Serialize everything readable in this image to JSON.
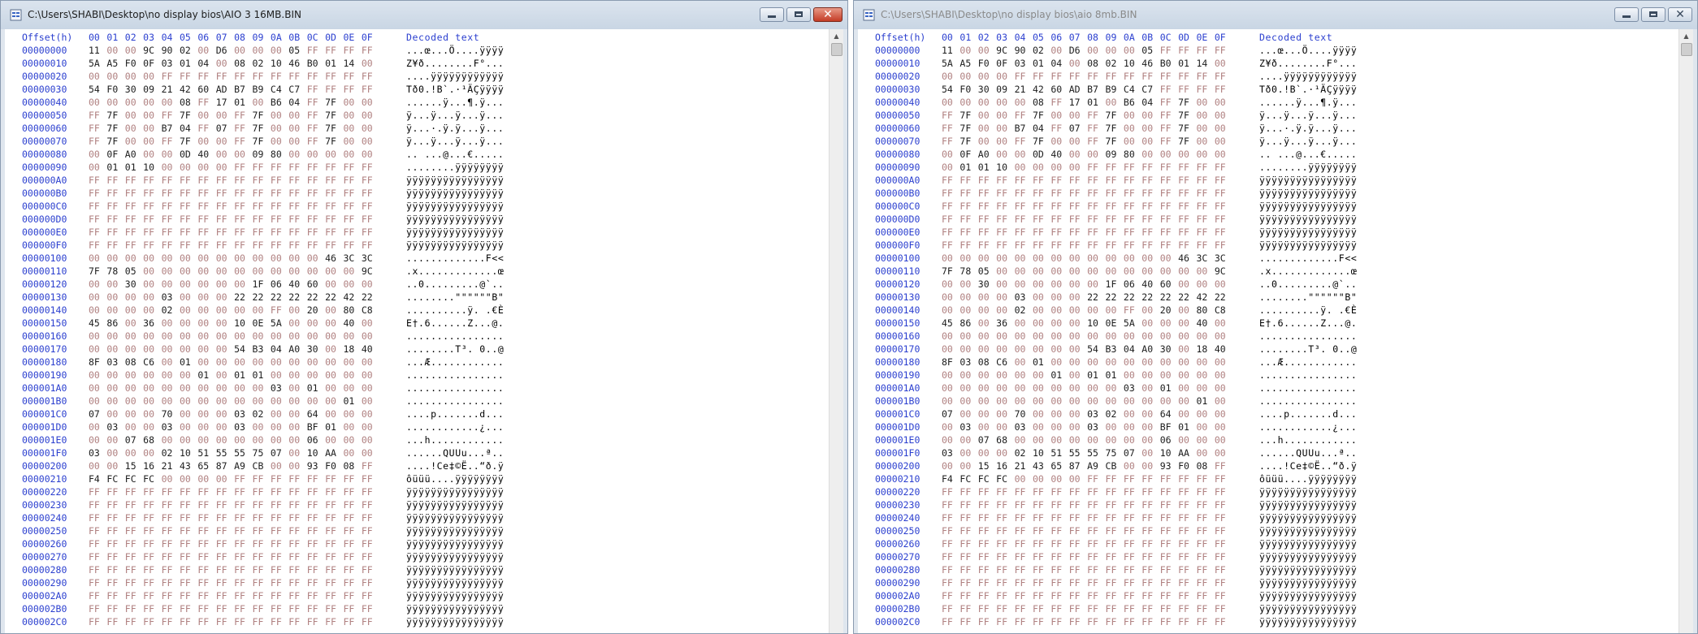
{
  "windows": [
    {
      "id": "left",
      "title": "C:\\Users\\SHABI\\Desktop\\no display bios\\AIO 3 16MB.BIN"
    },
    {
      "id": "right",
      "title": "C:\\Users\\SHABI\\Desktop\\no display bios\\aio 8mb.BIN"
    }
  ],
  "header": {
    "offset_label": "Offset(h)",
    "columns": [
      "00",
      "01",
      "02",
      "03",
      "04",
      "05",
      "06",
      "07",
      "08",
      "09",
      "0A",
      "0B",
      "0C",
      "0D",
      "0E",
      "0F"
    ],
    "decoded_label": "Decoded text"
  },
  "rows": [
    {
      "offset": "00000000",
      "bytes": [
        "11",
        "00",
        "00",
        "9C",
        "90",
        "02",
        "00",
        "D6",
        "00",
        "00",
        "00",
        "05",
        "FF",
        "FF",
        "FF",
        "FF"
      ],
      "text": "...œ...Ö....ÿÿÿÿ"
    },
    {
      "offset": "00000010",
      "bytes": [
        "5A",
        "A5",
        "F0",
        "0F",
        "03",
        "01",
        "04",
        "00",
        "08",
        "02",
        "10",
        "46",
        "B0",
        "01",
        "14",
        "00"
      ],
      "text": "Z¥ð........F°..."
    },
    {
      "offset": "00000020",
      "bytes": [
        "00",
        "00",
        "00",
        "00",
        "FF",
        "FF",
        "FF",
        "FF",
        "FF",
        "FF",
        "FF",
        "FF",
        "FF",
        "FF",
        "FF",
        "FF"
      ],
      "text": "....ÿÿÿÿÿÿÿÿÿÿÿÿ"
    },
    {
      "offset": "00000030",
      "bytes": [
        "54",
        "F0",
        "30",
        "09",
        "21",
        "42",
        "60",
        "AD",
        "B7",
        "B9",
        "C4",
        "C7",
        "FF",
        "FF",
        "FF",
        "FF"
      ],
      "text": "Tð0.!B`.·¹ÄÇÿÿÿÿ"
    },
    {
      "offset": "00000040",
      "bytes": [
        "00",
        "00",
        "00",
        "00",
        "00",
        "08",
        "FF",
        "17",
        "01",
        "00",
        "B6",
        "04",
        "FF",
        "7F",
        "00",
        "00"
      ],
      "text": "......ÿ...¶.ÿ..."
    },
    {
      "offset": "00000050",
      "bytes": [
        "FF",
        "7F",
        "00",
        "00",
        "FF",
        "7F",
        "00",
        "00",
        "FF",
        "7F",
        "00",
        "00",
        "FF",
        "7F",
        "00",
        "00"
      ],
      "text": "ÿ...ÿ...ÿ...ÿ..."
    },
    {
      "offset": "00000060",
      "bytes": [
        "FF",
        "7F",
        "00",
        "00",
        "B7",
        "04",
        "FF",
        "07",
        "FF",
        "7F",
        "00",
        "00",
        "FF",
        "7F",
        "00",
        "00"
      ],
      "text": "ÿ...·.ÿ.ÿ...ÿ..."
    },
    {
      "offset": "00000070",
      "bytes": [
        "FF",
        "7F",
        "00",
        "00",
        "FF",
        "7F",
        "00",
        "00",
        "FF",
        "7F",
        "00",
        "00",
        "FF",
        "7F",
        "00",
        "00"
      ],
      "text": "ÿ...ÿ...ÿ...ÿ..."
    },
    {
      "offset": "00000080",
      "bytes": [
        "00",
        "0F",
        "A0",
        "00",
        "00",
        "0D",
        "40",
        "00",
        "00",
        "09",
        "80",
        "00",
        "00",
        "00",
        "00",
        "00"
      ],
      "text": ".. ...@...€....."
    },
    {
      "offset": "00000090",
      "bytes": [
        "00",
        "01",
        "01",
        "10",
        "00",
        "00",
        "00",
        "00",
        "FF",
        "FF",
        "FF",
        "FF",
        "FF",
        "FF",
        "FF",
        "FF"
      ],
      "text": "........ÿÿÿÿÿÿÿÿ"
    },
    {
      "offset": "000000A0",
      "bytes": [
        "FF",
        "FF",
        "FF",
        "FF",
        "FF",
        "FF",
        "FF",
        "FF",
        "FF",
        "FF",
        "FF",
        "FF",
        "FF",
        "FF",
        "FF",
        "FF"
      ],
      "text": "ÿÿÿÿÿÿÿÿÿÿÿÿÿÿÿÿ"
    },
    {
      "offset": "000000B0",
      "bytes": [
        "FF",
        "FF",
        "FF",
        "FF",
        "FF",
        "FF",
        "FF",
        "FF",
        "FF",
        "FF",
        "FF",
        "FF",
        "FF",
        "FF",
        "FF",
        "FF"
      ],
      "text": "ÿÿÿÿÿÿÿÿÿÿÿÿÿÿÿÿ"
    },
    {
      "offset": "000000C0",
      "bytes": [
        "FF",
        "FF",
        "FF",
        "FF",
        "FF",
        "FF",
        "FF",
        "FF",
        "FF",
        "FF",
        "FF",
        "FF",
        "FF",
        "FF",
        "FF",
        "FF"
      ],
      "text": "ÿÿÿÿÿÿÿÿÿÿÿÿÿÿÿÿ"
    },
    {
      "offset": "000000D0",
      "bytes": [
        "FF",
        "FF",
        "FF",
        "FF",
        "FF",
        "FF",
        "FF",
        "FF",
        "FF",
        "FF",
        "FF",
        "FF",
        "FF",
        "FF",
        "FF",
        "FF"
      ],
      "text": "ÿÿÿÿÿÿÿÿÿÿÿÿÿÿÿÿ"
    },
    {
      "offset": "000000E0",
      "bytes": [
        "FF",
        "FF",
        "FF",
        "FF",
        "FF",
        "FF",
        "FF",
        "FF",
        "FF",
        "FF",
        "FF",
        "FF",
        "FF",
        "FF",
        "FF",
        "FF"
      ],
      "text": "ÿÿÿÿÿÿÿÿÿÿÿÿÿÿÿÿ"
    },
    {
      "offset": "000000F0",
      "bytes": [
        "FF",
        "FF",
        "FF",
        "FF",
        "FF",
        "FF",
        "FF",
        "FF",
        "FF",
        "FF",
        "FF",
        "FF",
        "FF",
        "FF",
        "FF",
        "FF"
      ],
      "text": "ÿÿÿÿÿÿÿÿÿÿÿÿÿÿÿÿ"
    },
    {
      "offset": "00000100",
      "bytes": [
        "00",
        "00",
        "00",
        "00",
        "00",
        "00",
        "00",
        "00",
        "00",
        "00",
        "00",
        "00",
        "00",
        "46",
        "3C",
        "3C"
      ],
      "text": ".............F<<"
    },
    {
      "offset": "00000110",
      "bytes": [
        "7F",
        "78",
        "05",
        "00",
        "00",
        "00",
        "00",
        "00",
        "00",
        "00",
        "00",
        "00",
        "00",
        "00",
        "00",
        "9C"
      ],
      "text": ".x.............œ"
    },
    {
      "offset": "00000120",
      "bytes": [
        "00",
        "00",
        "30",
        "00",
        "00",
        "00",
        "00",
        "00",
        "00",
        "1F",
        "06",
        "40",
        "60",
        "00",
        "00",
        "00"
      ],
      "text": "..0.........@`.."
    },
    {
      "offset": "00000130",
      "bytes": [
        "00",
        "00",
        "00",
        "00",
        "03",
        "00",
        "00",
        "00",
        "22",
        "22",
        "22",
        "22",
        "22",
        "22",
        "42",
        "22"
      ],
      "text": "........\"\"\"\"\"\"B\""
    },
    {
      "offset": "00000140",
      "bytes": [
        "00",
        "00",
        "00",
        "00",
        "02",
        "00",
        "00",
        "00",
        "00",
        "00",
        "FF",
        "00",
        "20",
        "00",
        "80",
        "C8"
      ],
      "text": "..........ÿ. .€È"
    },
    {
      "offset": "00000150",
      "bytes": [
        "45",
        "86",
        "00",
        "36",
        "00",
        "00",
        "00",
        "00",
        "10",
        "0E",
        "5A",
        "00",
        "00",
        "00",
        "40",
        "00"
      ],
      "text": "E†.6......Z...@."
    },
    {
      "offset": "00000160",
      "bytes": [
        "00",
        "00",
        "00",
        "00",
        "00",
        "00",
        "00",
        "00",
        "00",
        "00",
        "00",
        "00",
        "00",
        "00",
        "00",
        "00"
      ],
      "text": "................"
    },
    {
      "offset": "00000170",
      "bytes": [
        "00",
        "00",
        "00",
        "00",
        "00",
        "00",
        "00",
        "00",
        "54",
        "B3",
        "04",
        "A0",
        "30",
        "00",
        "18",
        "40"
      ],
      "text": "........T³. 0..@"
    },
    {
      "offset": "00000180",
      "bytes": [
        "8F",
        "03",
        "08",
        "C6",
        "00",
        "01",
        "00",
        "00",
        "00",
        "00",
        "00",
        "00",
        "00",
        "00",
        "00",
        "00"
      ],
      "text": "...Æ............"
    },
    {
      "offset": "00000190",
      "bytes": [
        "00",
        "00",
        "00",
        "00",
        "00",
        "00",
        "01",
        "00",
        "01",
        "01",
        "00",
        "00",
        "00",
        "00",
        "00",
        "00"
      ],
      "text": "................"
    },
    {
      "offset": "000001A0",
      "bytes": [
        "00",
        "00",
        "00",
        "00",
        "00",
        "00",
        "00",
        "00",
        "00",
        "00",
        "03",
        "00",
        "01",
        "00",
        "00",
        "00"
      ],
      "text": "................"
    },
    {
      "offset": "000001B0",
      "bytes": [
        "00",
        "00",
        "00",
        "00",
        "00",
        "00",
        "00",
        "00",
        "00",
        "00",
        "00",
        "00",
        "00",
        "00",
        "01",
        "00"
      ],
      "text": "................"
    },
    {
      "offset": "000001C0",
      "bytes": [
        "07",
        "00",
        "00",
        "00",
        "70",
        "00",
        "00",
        "00",
        "03",
        "02",
        "00",
        "00",
        "64",
        "00",
        "00",
        "00"
      ],
      "text": "....p.......d..."
    },
    {
      "offset": "000001D0",
      "bytes": [
        "00",
        "03",
        "00",
        "00",
        "03",
        "00",
        "00",
        "00",
        "03",
        "00",
        "00",
        "00",
        "BF",
        "01",
        "00",
        "00"
      ],
      "text": "............¿..."
    },
    {
      "offset": "000001E0",
      "bytes": [
        "00",
        "00",
        "07",
        "68",
        "00",
        "00",
        "00",
        "00",
        "00",
        "00",
        "00",
        "00",
        "06",
        "00",
        "00",
        "00"
      ],
      "text": "...h............"
    },
    {
      "offset": "000001F0",
      "bytes": [
        "03",
        "00",
        "00",
        "00",
        "02",
        "10",
        "51",
        "55",
        "55",
        "75",
        "07",
        "00",
        "10",
        "AA",
        "00",
        "00"
      ],
      "text": "......QUUu...ª.."
    },
    {
      "offset": "00000200",
      "bytes": [
        "00",
        "00",
        "15",
        "16",
        "21",
        "43",
        "65",
        "87",
        "A9",
        "CB",
        "00",
        "00",
        "93",
        "F0",
        "08",
        "FF"
      ],
      "text": "....!Ce‡©Ë..“ð.ÿ"
    },
    {
      "offset": "00000210",
      "bytes": [
        "F4",
        "FC",
        "FC",
        "FC",
        "00",
        "00",
        "00",
        "00",
        "FF",
        "FF",
        "FF",
        "FF",
        "FF",
        "FF",
        "FF",
        "FF"
      ],
      "text": "ôüüü....ÿÿÿÿÿÿÿÿ"
    },
    {
      "offset": "00000220",
      "bytes": [
        "FF",
        "FF",
        "FF",
        "FF",
        "FF",
        "FF",
        "FF",
        "FF",
        "FF",
        "FF",
        "FF",
        "FF",
        "FF",
        "FF",
        "FF",
        "FF"
      ],
      "text": "ÿÿÿÿÿÿÿÿÿÿÿÿÿÿÿÿ"
    },
    {
      "offset": "00000230",
      "bytes": [
        "FF",
        "FF",
        "FF",
        "FF",
        "FF",
        "FF",
        "FF",
        "FF",
        "FF",
        "FF",
        "FF",
        "FF",
        "FF",
        "FF",
        "FF",
        "FF"
      ],
      "text": "ÿÿÿÿÿÿÿÿÿÿÿÿÿÿÿÿ"
    },
    {
      "offset": "00000240",
      "bytes": [
        "FF",
        "FF",
        "FF",
        "FF",
        "FF",
        "FF",
        "FF",
        "FF",
        "FF",
        "FF",
        "FF",
        "FF",
        "FF",
        "FF",
        "FF",
        "FF"
      ],
      "text": "ÿÿÿÿÿÿÿÿÿÿÿÿÿÿÿÿ"
    },
    {
      "offset": "00000250",
      "bytes": [
        "FF",
        "FF",
        "FF",
        "FF",
        "FF",
        "FF",
        "FF",
        "FF",
        "FF",
        "FF",
        "FF",
        "FF",
        "FF",
        "FF",
        "FF",
        "FF"
      ],
      "text": "ÿÿÿÿÿÿÿÿÿÿÿÿÿÿÿÿ"
    },
    {
      "offset": "00000260",
      "bytes": [
        "FF",
        "FF",
        "FF",
        "FF",
        "FF",
        "FF",
        "FF",
        "FF",
        "FF",
        "FF",
        "FF",
        "FF",
        "FF",
        "FF",
        "FF",
        "FF"
      ],
      "text": "ÿÿÿÿÿÿÿÿÿÿÿÿÿÿÿÿ"
    },
    {
      "offset": "00000270",
      "bytes": [
        "FF",
        "FF",
        "FF",
        "FF",
        "FF",
        "FF",
        "FF",
        "FF",
        "FF",
        "FF",
        "FF",
        "FF",
        "FF",
        "FF",
        "FF",
        "FF"
      ],
      "text": "ÿÿÿÿÿÿÿÿÿÿÿÿÿÿÿÿ"
    },
    {
      "offset": "00000280",
      "bytes": [
        "FF",
        "FF",
        "FF",
        "FF",
        "FF",
        "FF",
        "FF",
        "FF",
        "FF",
        "FF",
        "FF",
        "FF",
        "FF",
        "FF",
        "FF",
        "FF"
      ],
      "text": "ÿÿÿÿÿÿÿÿÿÿÿÿÿÿÿÿ"
    },
    {
      "offset": "00000290",
      "bytes": [
        "FF",
        "FF",
        "FF",
        "FF",
        "FF",
        "FF",
        "FF",
        "FF",
        "FF",
        "FF",
        "FF",
        "FF",
        "FF",
        "FF",
        "FF",
        "FF"
      ],
      "text": "ÿÿÿÿÿÿÿÿÿÿÿÿÿÿÿÿ"
    },
    {
      "offset": "000002A0",
      "bytes": [
        "FF",
        "FF",
        "FF",
        "FF",
        "FF",
        "FF",
        "FF",
        "FF",
        "FF",
        "FF",
        "FF",
        "FF",
        "FF",
        "FF",
        "FF",
        "FF"
      ],
      "text": "ÿÿÿÿÿÿÿÿÿÿÿÿÿÿÿÿ"
    },
    {
      "offset": "000002B0",
      "bytes": [
        "FF",
        "FF",
        "FF",
        "FF",
        "FF",
        "FF",
        "FF",
        "FF",
        "FF",
        "FF",
        "FF",
        "FF",
        "FF",
        "FF",
        "FF",
        "FF"
      ],
      "text": "ÿÿÿÿÿÿÿÿÿÿÿÿÿÿÿÿ"
    },
    {
      "offset": "000002C0",
      "bytes": [
        "FF",
        "FF",
        "FF",
        "FF",
        "FF",
        "FF",
        "FF",
        "FF",
        "FF",
        "FF",
        "FF",
        "FF",
        "FF",
        "FF",
        "FF",
        "FF"
      ],
      "text": "ÿÿÿÿÿÿÿÿÿÿÿÿÿÿÿÿ"
    }
  ],
  "icons": {
    "window": "hex-document-icon",
    "minimize": "minimize-icon",
    "maximize": "maximize-icon",
    "close": "close-icon"
  },
  "colors": {
    "offset": "#2b3fcf",
    "zero_byte": "#b08080",
    "other_byte": "#1c1c1c",
    "close_button": "#c43c26"
  }
}
